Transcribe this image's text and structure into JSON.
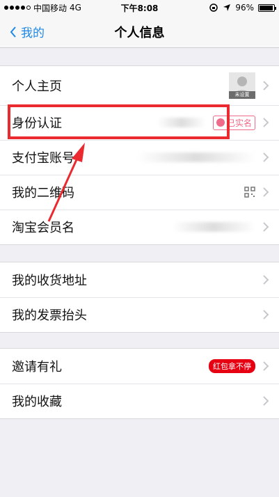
{
  "status_bar": {
    "carrier": "中国移动",
    "network": "4G",
    "time": "下午8:08",
    "battery_percent": "96%",
    "battery_level": 0.96
  },
  "nav": {
    "back_label": "我的",
    "title": "个人信息"
  },
  "groups": [
    {
      "items": [
        {
          "label": "个人主页",
          "avatar_caption": "未设置"
        },
        {
          "label": "身份认证",
          "badge": "已实名"
        },
        {
          "label": "支付宝账号"
        },
        {
          "label": "我的二维码"
        },
        {
          "label": "淘宝会员名"
        }
      ]
    },
    {
      "items": [
        {
          "label": "我的收货地址"
        },
        {
          "label": "我的发票抬头"
        }
      ]
    },
    {
      "items": [
        {
          "label": "邀请有礼",
          "badge": "红包拿不停"
        },
        {
          "label": "我的收藏"
        }
      ]
    }
  ],
  "colors": {
    "accent": "#1e88e5",
    "highlight": "#ea2a2f",
    "badge_red": "#e60012",
    "verified_pink": "#f06a8a"
  }
}
